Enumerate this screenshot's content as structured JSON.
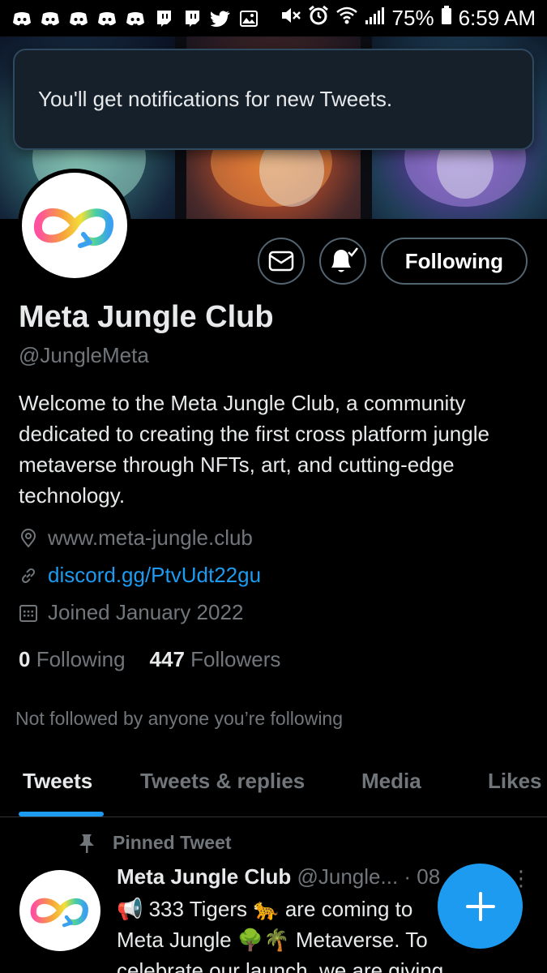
{
  "status_bar": {
    "battery": "75%",
    "time": "6:59 AM",
    "notification_icons": [
      "discord-icon",
      "discord-icon",
      "discord-icon",
      "discord-icon",
      "discord-icon",
      "twitch-icon",
      "twitch-icon",
      "twitter-icon",
      "gallery-icon"
    ],
    "system_icons": [
      "mute-icon",
      "alarm-icon",
      "wifi-icon",
      "signal-icon",
      "battery-icon"
    ]
  },
  "toast": {
    "message": "You'll get notifications for new Tweets."
  },
  "profile": {
    "name": "Meta Jungle Club",
    "handle": "@JungleMeta",
    "bio": "Welcome to the Meta Jungle Club, a community dedicated to creating the first cross platform jungle metaverse through NFTs, art, and cutting-edge technology.",
    "location": "www.meta-jungle.club",
    "link": "discord.gg/PtvUdt22gu",
    "joined": "Joined January 2022",
    "following_count": "0",
    "following_label": "Following",
    "followers_count": "447",
    "followers_label": "Followers",
    "not_followed": "Not followed by anyone you’re following"
  },
  "actions": {
    "following_label": "Following"
  },
  "tabs": [
    {
      "label": "Tweets",
      "active": true
    },
    {
      "label": "Tweets & replies",
      "active": false
    },
    {
      "label": "Media",
      "active": false
    },
    {
      "label": "Likes",
      "active": false
    }
  ],
  "pinned_tweet": {
    "pinned_label": "Pinned Tweet",
    "author_name": "Meta Jungle Club",
    "author_handle": "@Jungle...",
    "date_fragment": "· 08",
    "text_line1": "📢 333 Tigers 🐆 are coming to",
    "text_line2": "Meta Jungle 🌳🌴 Metaverse. To",
    "text_line3": "celebrate our launch, we are giving"
  },
  "colors": {
    "accent": "#1d9bf0",
    "background": "#000000",
    "toast_bg": "#15202b",
    "secondary_text": "#71767b"
  }
}
